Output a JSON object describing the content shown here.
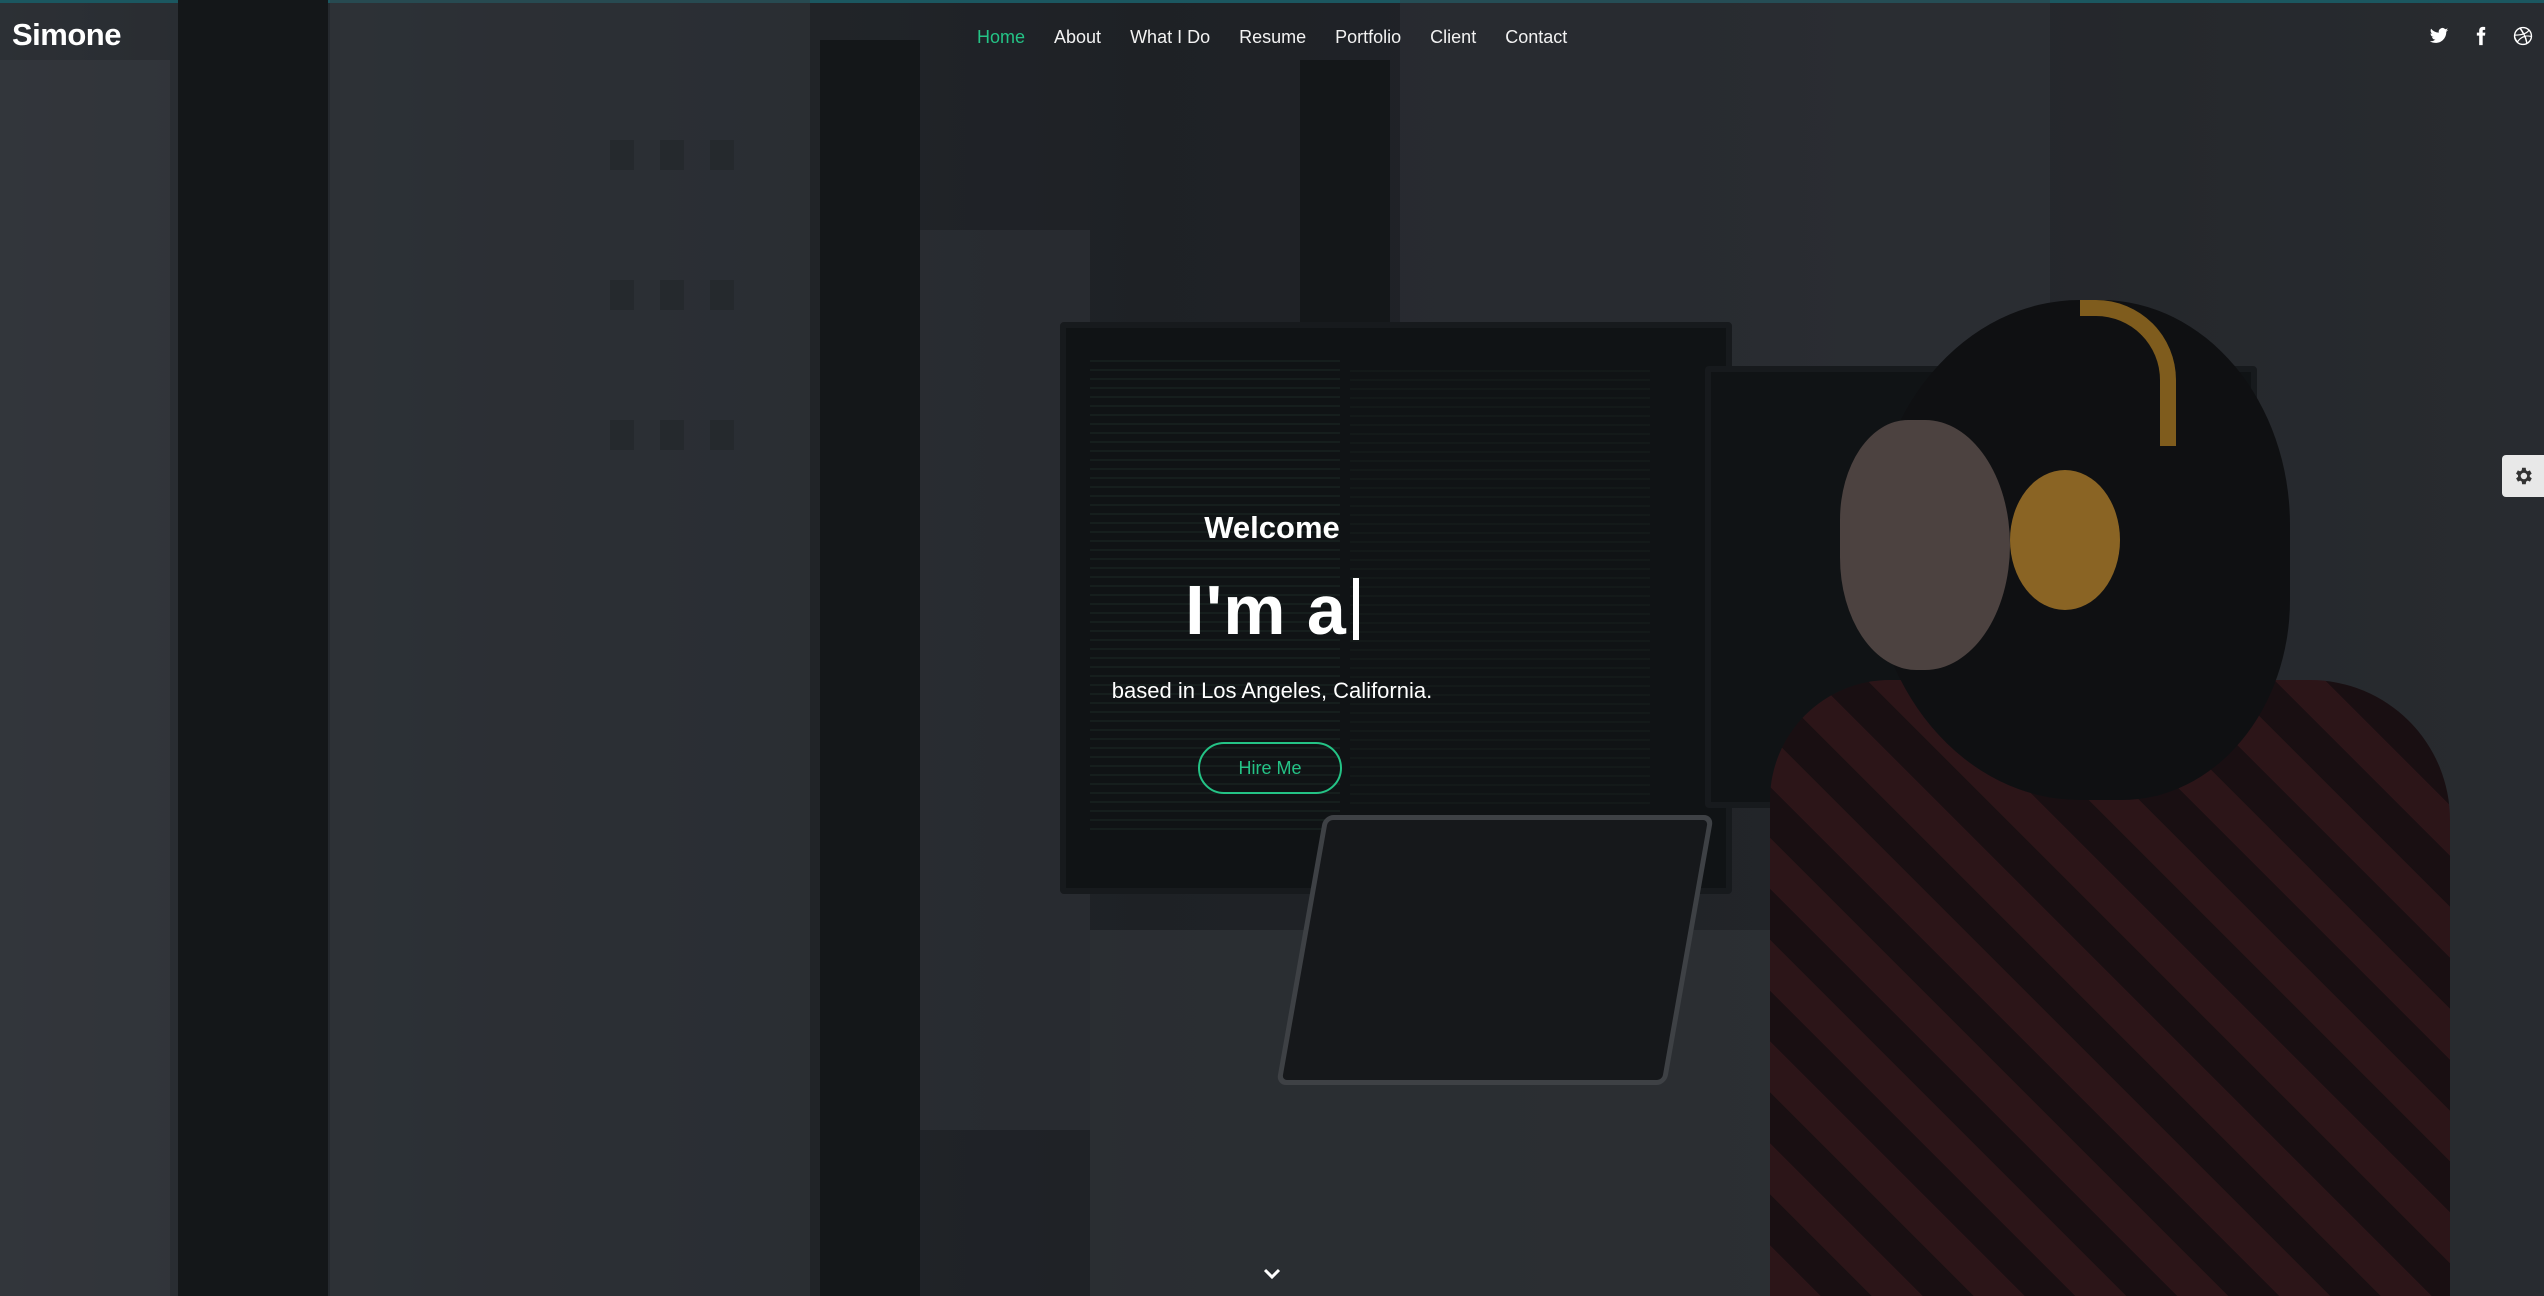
{
  "header": {
    "logo": "Simone",
    "nav": [
      {
        "label": "Home",
        "active": true
      },
      {
        "label": "About",
        "active": false
      },
      {
        "label": "What I Do",
        "active": false
      },
      {
        "label": "Resume",
        "active": false
      },
      {
        "label": "Portfolio",
        "active": false
      },
      {
        "label": "Client",
        "active": false
      },
      {
        "label": "Contact",
        "active": false
      }
    ],
    "social": [
      "twitter-icon",
      "facebook-icon",
      "dribbble-icon"
    ]
  },
  "hero": {
    "welcome": "Welcome",
    "headline": "I'm a",
    "location": "based in Los Angeles, California.",
    "cta": "Hire Me"
  },
  "settings": {
    "icon": "gear-icon"
  },
  "scroll": {
    "icon": "chevron-down-icon"
  },
  "colors": {
    "accent": "#24c386",
    "text": "#ffffff",
    "top_accent": "#1f7a86"
  }
}
